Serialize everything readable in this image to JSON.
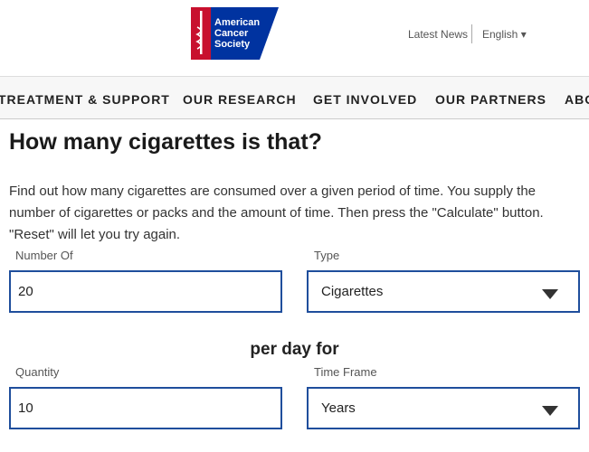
{
  "header": {
    "logo_text": "American Cancer Society",
    "latest_news": "Latest News",
    "language": "English",
    "brand_red": "#c8102e",
    "brand_blue": "#0033a0"
  },
  "nav": {
    "items": [
      "TREATMENT & SUPPORT",
      "OUR RESEARCH",
      "GET INVOLVED",
      "OUR PARTNERS",
      "ABO"
    ]
  },
  "main": {
    "title": "How many cigarettes is that?",
    "description": "Find out how many cigarettes are consumed over a given period of time. You supply the number of cigarettes or packs and the amount of time. Then press the \"Calculate\" button. \"Reset\" will let you try again.",
    "number_of_label": "Number Of",
    "number_of_value": "20",
    "type_label": "Type",
    "type_value": "Cigarettes",
    "per_day_for": "per day for",
    "quantity_label": "Quantity",
    "quantity_value": "10",
    "time_frame_label": "Time Frame",
    "time_frame_value": "Years"
  }
}
